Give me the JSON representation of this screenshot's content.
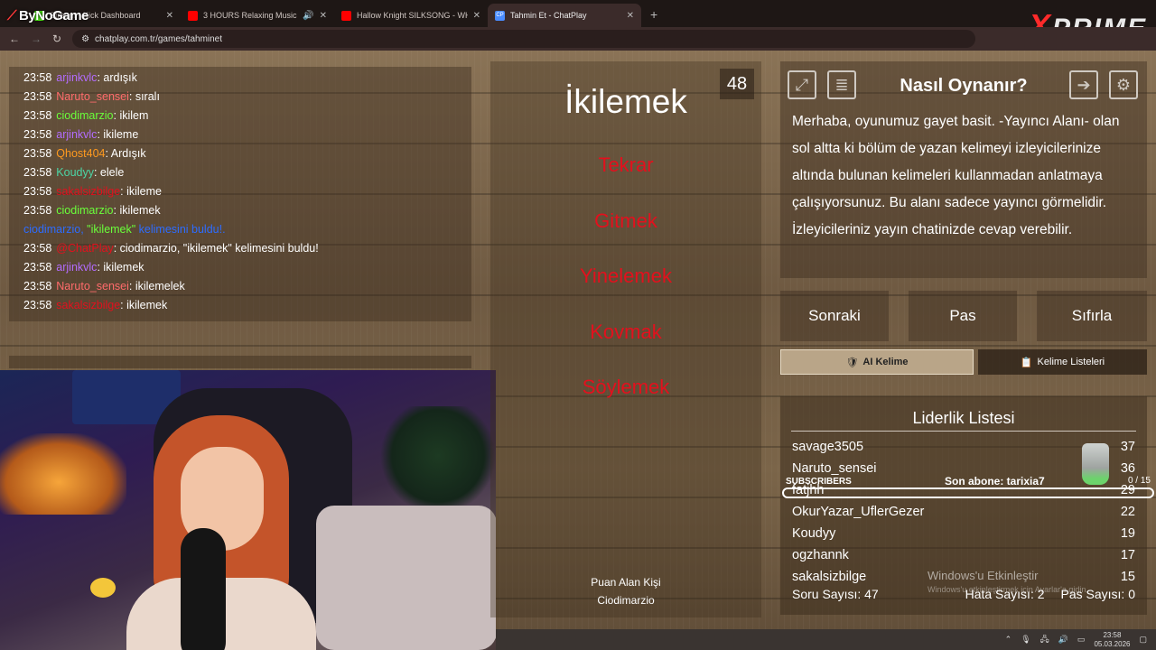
{
  "browser": {
    "tabs": [
      {
        "title": "Stream - Kick Dashboard",
        "active": false,
        "fav_color": "#53fc18"
      },
      {
        "title": "3 HOURS Relaxing Music \"I",
        "active": false,
        "fav_color": "#ff0000",
        "audio_icon": "speaker-icon"
      },
      {
        "title": "Hallow Knight SILKSONG - WH",
        "active": false,
        "fav_color": "#ff0000"
      },
      {
        "title": "Tahmin Et - ChatPlay",
        "active": true,
        "fav_color": "#4a8cff",
        "fav_text": "CP"
      }
    ],
    "url": "chatplay.com.tr/games/tahminet",
    "overlay_brand": "ByNoGame",
    "overlay_logo": "PRIME",
    "overlay_logo_x": "X"
  },
  "chat": {
    "messages": [
      {
        "time": "23:58",
        "user": "arjinkvlc",
        "color": "#b36cff",
        "text": ": ardışık"
      },
      {
        "time": "23:58",
        "user": "Naruto_sensei",
        "color": "#ff6b6b",
        "text": ": sıralı"
      },
      {
        "time": "23:58",
        "user": "ciodimarzio",
        "color": "#6aff3a",
        "text": ": ikilem"
      },
      {
        "time": "23:58",
        "user": "arjinkvlc",
        "color": "#b36cff",
        "text": ": ikileme"
      },
      {
        "time": "23:58",
        "user": "Qhost404",
        "color": "#ff9a1f",
        "text": ": Ardışık"
      },
      {
        "time": "23:58",
        "user": "Koudyy",
        "color": "#4cd6a6",
        "text": ": elele"
      },
      {
        "time": "23:58",
        "user": "sakalsizbilge",
        "color": "#e3101d",
        "text": ": ikileme"
      },
      {
        "time": "23:58",
        "user": "ciodimarzio",
        "color": "#6aff3a",
        "text": ": ikilemek"
      }
    ],
    "system_line": {
      "user": "ciodimarzio, ",
      "word": "\"ikilemek\"",
      "text": " kelimesini buldu!."
    },
    "messages_after": [
      {
        "time": "23:58",
        "user": "@ChatPlay",
        "color": "#e3101d",
        "text": ": ciodimarzio, \"ikilemek\" kelimesini buldu!"
      },
      {
        "time": "23:58",
        "user": "arjinkvlc",
        "color": "#b36cff",
        "text": ": ikilemek"
      },
      {
        "time": "23:58",
        "user": "Naruto_sensei",
        "color": "#ff6b6b",
        "text": ": ikilemelek"
      },
      {
        "time": "23:58",
        "user": "sakalsizbilge",
        "color": "#e3101d",
        "text": ": ikilemek"
      }
    ]
  },
  "game": {
    "counter": "48",
    "word": "İkilemek",
    "forbidden": [
      "Tekrar",
      "Gitmek",
      "Yinelemek",
      "Kovmak",
      "Söylemek"
    ],
    "scorer_label": "Puan Alan Kişi",
    "scorer_name": "Ciodimarzio"
  },
  "info": {
    "title": "Nasıl Oynanır?",
    "text": "Merhaba, oyunumuz gayet basit. -Yayıncı Alanı- olan sol altta ki bölüm de yazan kelimeyi izleyicilerinize altında bulunan kelimeleri kullanmadan anlatmaya çalışıyorsunuz. Bu alanı sadece yayıncı görmelidir. İzleyicileriniz yayın chatinizde cevap verebilir."
  },
  "buttons": {
    "next": "Sonraki",
    "pass": "Pas",
    "reset": "Sıfırla",
    "ai_word": "AI Kelime",
    "word_lists": "Kelime Listeleri"
  },
  "leaderboard": {
    "title": "Liderlik Listesi",
    "rows": [
      {
        "name": "savage3505",
        "score": "37"
      },
      {
        "name": "Naruto_sensei",
        "score": "36"
      },
      {
        "name": "fatjhh",
        "score": "29"
      },
      {
        "name": "OkurYazar_UflerGezer",
        "score": "22"
      },
      {
        "name": "Koudyy",
        "score": "19"
      },
      {
        "name": "ogzhannk",
        "score": "17"
      },
      {
        "name": "sakalsizbilge",
        "score": "15"
      }
    ],
    "question_count": "Soru Sayısı: 47",
    "error_count": "Hata Sayısı: 2",
    "pass_count": "Pas Sayısı: 0"
  },
  "subs_overlay": {
    "label": "SUBSCRIBERS",
    "last": "Son abone: tarixia7",
    "count": "0 / 15",
    "progress": 0
  },
  "watermark": {
    "line1": "Windows'u Etkinleştir",
    "line2": "Windows'u etkinleştirmek için Ayarlar'a gidin."
  },
  "taskbar": {
    "time": "23:58",
    "date": "05.03.2026"
  }
}
